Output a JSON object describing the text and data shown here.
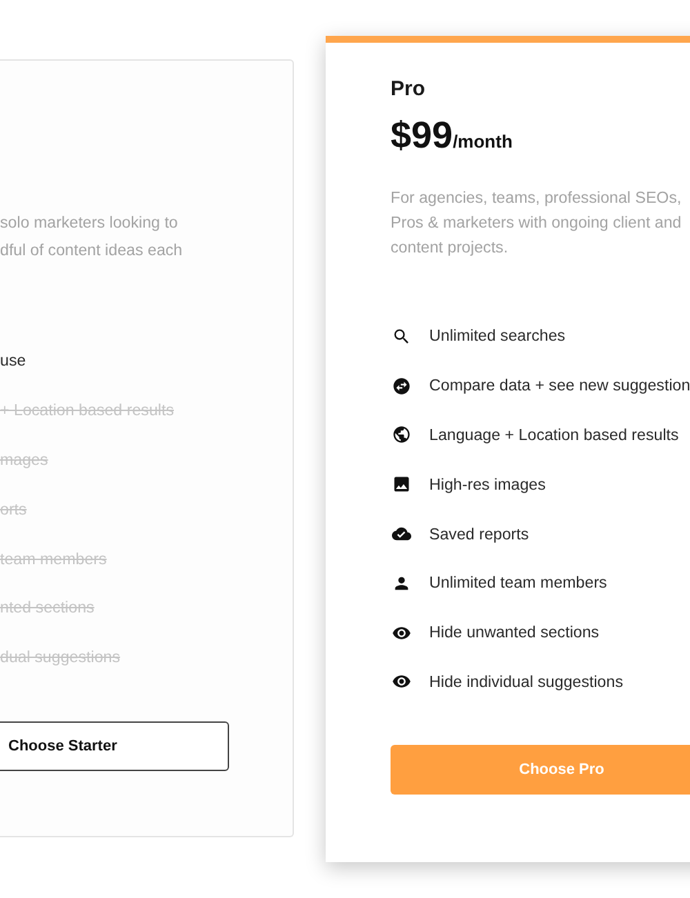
{
  "plans": [
    {
      "highlighted": false,
      "description_lines": [
        "solo marketers looking to",
        "dful of content ideas each"
      ],
      "features": [
        {
          "label": "use",
          "included": true
        },
        {
          "label": "+ Location based results",
          "included": false
        },
        {
          "label": "mages",
          "included": false
        },
        {
          "label": "orts",
          "included": false
        },
        {
          "label": "team members",
          "included": false
        },
        {
          "label": "nted sections",
          "included": false
        },
        {
          "label": "dual suggestions",
          "included": false
        }
      ],
      "button": "Choose Starter"
    },
    {
      "name": "Pro",
      "price": "$99",
      "period": "/month",
      "highlighted": true,
      "description_lines": [
        "For agencies, teams, professional SEOs,",
        "Pros & marketers with ongoing client and",
        "content projects."
      ],
      "features": [
        {
          "label": "Unlimited searches",
          "included": true
        },
        {
          "label": "Compare data + see new suggestion",
          "included": true
        },
        {
          "label": "Language + Location based results",
          "included": true
        },
        {
          "label": "High-res images",
          "included": true
        },
        {
          "label": "Saved reports",
          "included": true
        },
        {
          "label": "Unlimited team members",
          "included": true
        },
        {
          "label": "Hide unwanted sections",
          "included": true
        },
        {
          "label": "Hide individual suggestions",
          "included": true
        }
      ],
      "button": "Choose Pro"
    }
  ]
}
